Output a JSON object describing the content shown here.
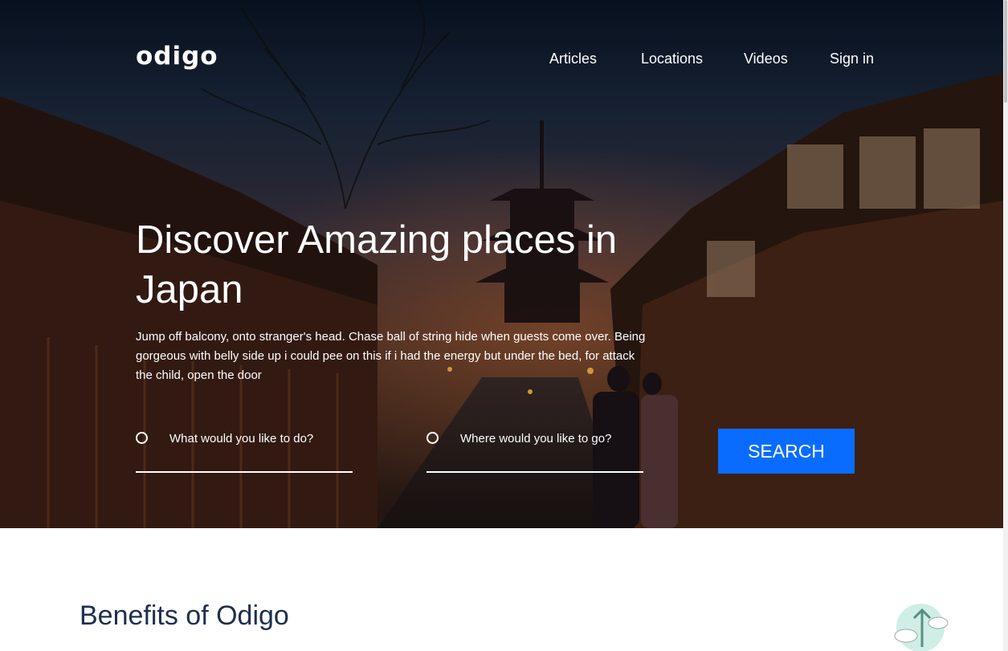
{
  "header": {
    "logo": "odigo",
    "nav": [
      "Articles",
      "Locations",
      "Videos",
      "Sign in"
    ]
  },
  "hero": {
    "title": "Discover Amazing places in Japan",
    "description": "Jump off balcony, onto stranger's head. Chase ball of string hide when guests come over. Being gorgeous with belly side up i could pee on this if i had the energy but under the bed, for attack the child, open the door",
    "search": {
      "activity_placeholder": "What would you like to do?",
      "location_placeholder": "Where would you like to go?",
      "button_label": "SEARCH"
    }
  },
  "benefits": {
    "heading": "Benefits of Odigo"
  },
  "colors": {
    "accent": "#0a6cff",
    "heading": "#1e2f4d"
  }
}
